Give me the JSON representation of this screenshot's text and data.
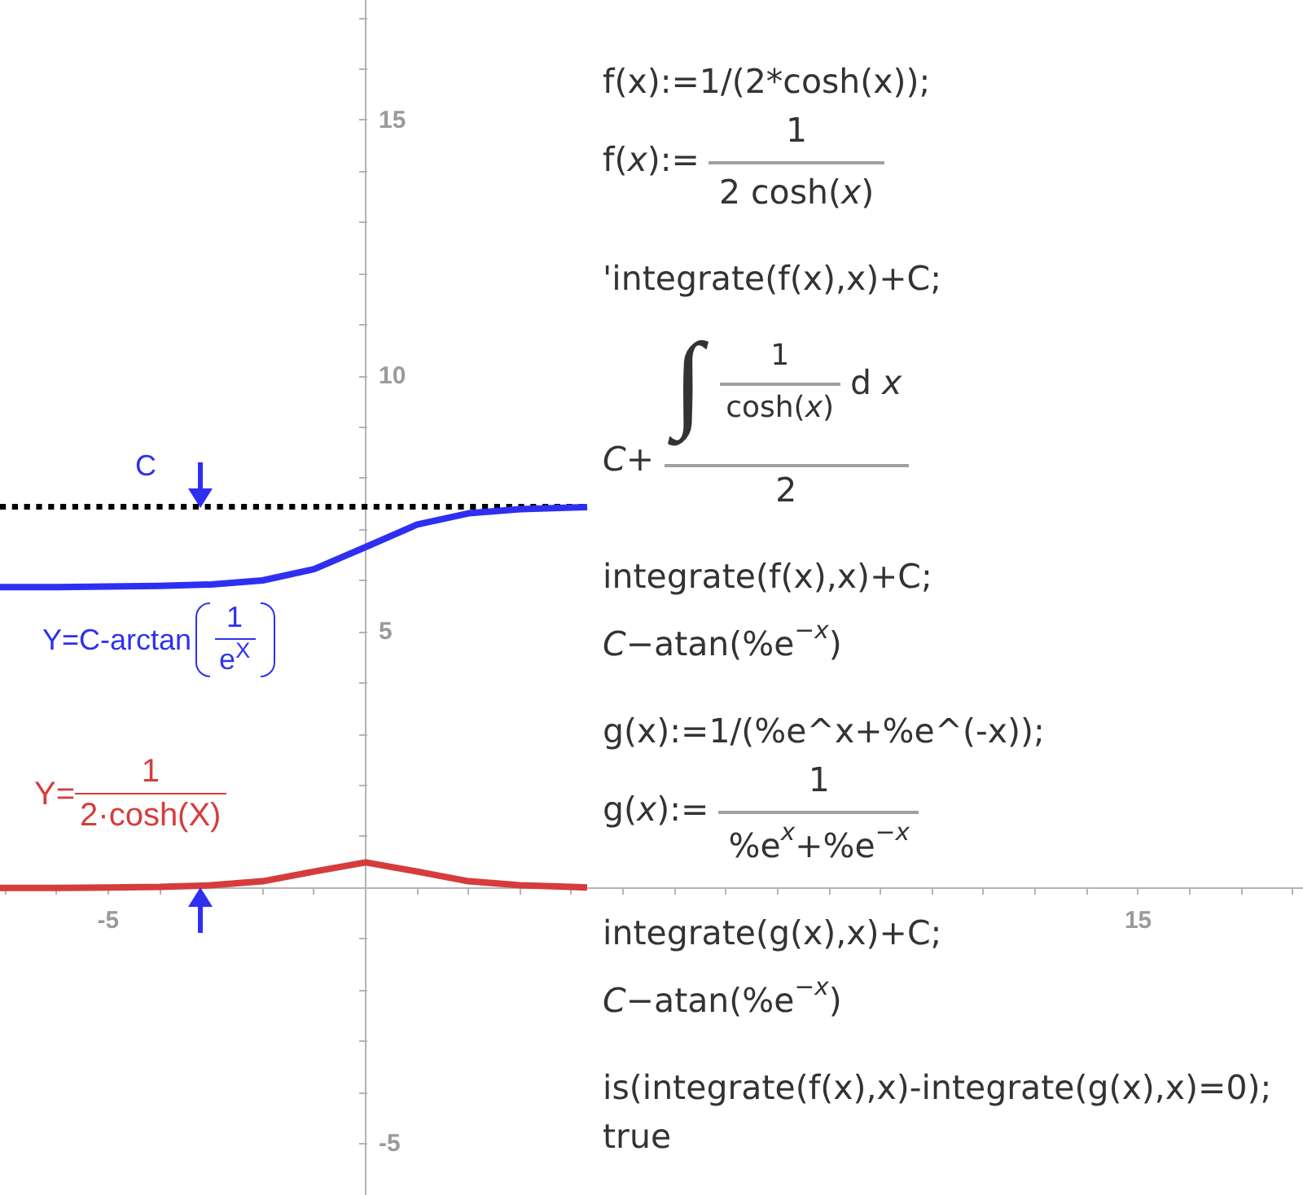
{
  "plot": {
    "chart_data": {
      "type": "line",
      "x": [
        -7.1,
        -7,
        -6,
        -5,
        -4,
        -3,
        -2,
        -1,
        0,
        1,
        2,
        3,
        4,
        4.3
      ],
      "series": [
        {
          "color": "#2f2ff2",
          "values": [
            5.88,
            5.88,
            5.88,
            5.89,
            5.9,
            5.93,
            6.01,
            6.23,
            6.66,
            7.1,
            7.32,
            7.4,
            7.43,
            7.44
          ]
        },
        {
          "color": "#d63c3c",
          "values": [
            0,
            0,
            0,
            0.01,
            0.02,
            0.05,
            0.13,
            0.32,
            0.5,
            0.32,
            0.13,
            0.05,
            0.02,
            0.01
          ]
        }
      ],
      "xlim": [
        -7.1,
        18.2
      ],
      "ylim": [
        -6.0,
        17.35
      ],
      "xticks": [
        -5,
        15
      ],
      "yticks": [
        -5,
        5,
        10,
        15
      ],
      "ref_lines": [
        {
          "axis": "y",
          "value": 7.45,
          "color": "#000000"
        }
      ]
    },
    "constant_label": "C",
    "arrows": [
      {
        "kind": "down"
      },
      {
        "kind": "up"
      }
    ],
    "formulas": [
      {
        "prefix": "Y=C-arctan",
        "numerator": "1",
        "denominator": "e$^{X}$",
        "brackets": true,
        "color": "#2f2ff2"
      },
      {
        "prefix": "Y=",
        "numerator": "1",
        "denominator": "2·cosh(X)",
        "brackets": false,
        "color": "#d63c3c"
      }
    ]
  },
  "worksheet": {
    "cells": [
      {
        "input": "f(x):=1/(2*cosh(x));",
        "output": {
          "kind": "definition",
          "lhs": "f(*x*):=",
          "numerator": "1",
          "denominator": "2 cosh(*x*)"
        }
      },
      {
        "input": "'integrate(f(x),x)+C;",
        "output": {
          "kind": "integral",
          "prefix": "*C*+",
          "sign": "∫",
          "integrand_numerator": "1",
          "integrand_denominator": "cosh(*x*)",
          "differential": "d *x*",
          "denominator": "2"
        }
      },
      {
        "input": "integrate(f(x),x)+C;",
        "output": {
          "kind": "text",
          "text": "*C*−atan(%e$^{−x}$)"
        }
      },
      {
        "input": "g(x):=1/(%e^x+%e^(-x));",
        "output": {
          "kind": "definition",
          "lhs": "g(*x*):=",
          "numerator": "1",
          "denominator": "%e$^{x}$+%e$^{−x}$"
        }
      },
      {
        "input": "integrate(g(x),x)+C;",
        "output": {
          "kind": "text",
          "text": "*C*−atan(%e$^{−x}$)"
        }
      },
      {
        "input": "is(integrate(f(x),x)-integrate(g(x),x)=0);",
        "output": {
          "kind": "text",
          "text": "true"
        }
      }
    ]
  }
}
